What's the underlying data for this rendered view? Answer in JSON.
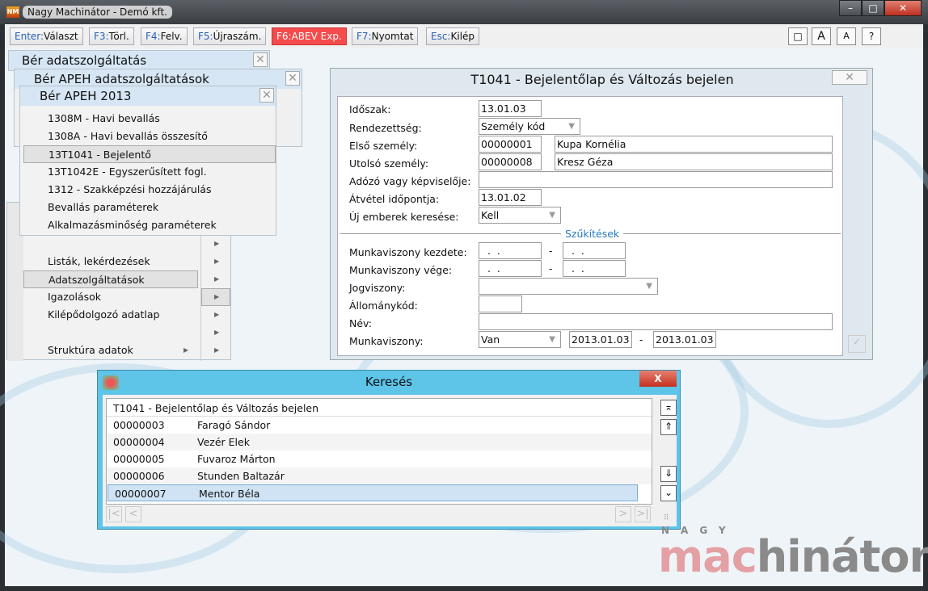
{
  "window": {
    "title": "Nagy Machinátor - Demó kft.",
    "app_logo": "NM",
    "min": "–",
    "max": "□",
    "close": "✕"
  },
  "toolbar": {
    "buttons": [
      {
        "key": "Enter:",
        "label": "Választ"
      },
      {
        "key": "F3:",
        "label": "Törl."
      },
      {
        "key": "F4:",
        "label": "Felv."
      },
      {
        "key": "F5:",
        "label": "Újraszám."
      },
      {
        "key": "F6:",
        "label": "ABEV Exp."
      },
      {
        "key": "F7:",
        "label": "Nyomtat"
      },
      {
        "key": "Esc:",
        "label": "Kilép"
      }
    ],
    "right": [
      "□",
      "A",
      "A",
      "?"
    ]
  },
  "menus": {
    "panel1": "Bér adatszolgáltatás",
    "panel2": "Bér APEH adatszolgáltatások",
    "panel3": "Bér APEH 2013",
    "close": "✕",
    "items": [
      "1308M - Havi bevallás",
      "1308A - Havi bevallás összesítő",
      "13T1041 - Bejelentő",
      "13T1042E - Egyszerűsített fogl.",
      "1312 - Szakképzési hozzájárulás",
      "Bevallás paraméterek",
      "Alkalmazásminőség paraméterek"
    ],
    "main": [
      "Listák, lekérdezések",
      "Adatszolgáltatások",
      "Igazolások",
      "Kilépődolgozó adatlap",
      "Struktúra adatok"
    ]
  },
  "form": {
    "title": "T1041 - Bejelentőlap és Változás bejelen",
    "close": "✕",
    "ok": "✓",
    "labels": {
      "idoszak": "Időszak:",
      "rend": "Rendezettség:",
      "elso": "Első személy:",
      "utolso": "Utolsó személy:",
      "adozo": "Adózó vagy képviselője:",
      "atvetel": "Átvétel időpontja:",
      "uj": "Új emberek keresése:",
      "szukites": "Szűkítések",
      "mkezd": "Munkaviszony kezdete:",
      "mvege": "Munkaviszony vége:",
      "jog": "Jogviszony:",
      "allomany": "Állománykód:",
      "nev": "Név:",
      "munka": "Munkaviszony:"
    },
    "values": {
      "idoszak": "13.01.03",
      "rend": "Személy kód",
      "elso_code": "00000001",
      "elso_name": "Kupa Kornélia",
      "utolso_code": "00000008",
      "utolso_name": "Kresz Géza",
      "adozo": "",
      "atvetel": "13.01.02",
      "uj": "Kell",
      "empty_date": "  .  .",
      "dash": "-",
      "jog": "",
      "allomany": "",
      "nev": "",
      "munka": "Van",
      "munka_from": "2013.01.03",
      "munka_to": "2013.01.03"
    }
  },
  "search": {
    "title": "Keresés",
    "close": "X",
    "header": "T1041 - Bejelentőlap és Változás bejelen",
    "rows": [
      {
        "code": "00000003",
        "name": "Faragó Sándor"
      },
      {
        "code": "00000004",
        "name": "Vezér Elek"
      },
      {
        "code": "00000005",
        "name": "Fuvaroz Márton"
      },
      {
        "code": "00000006",
        "name": "Stunden Baltazár"
      },
      {
        "code": "00000007",
        "name": "Mentor Béla"
      }
    ],
    "scroll": [
      "⌅",
      "⇑",
      "⇓",
      "⌄"
    ],
    "nav": [
      "|<",
      "<",
      ">",
      ">|"
    ]
  },
  "brand": {
    "top": "NAGY",
    "a": "mac",
    "b": "hinátor"
  }
}
